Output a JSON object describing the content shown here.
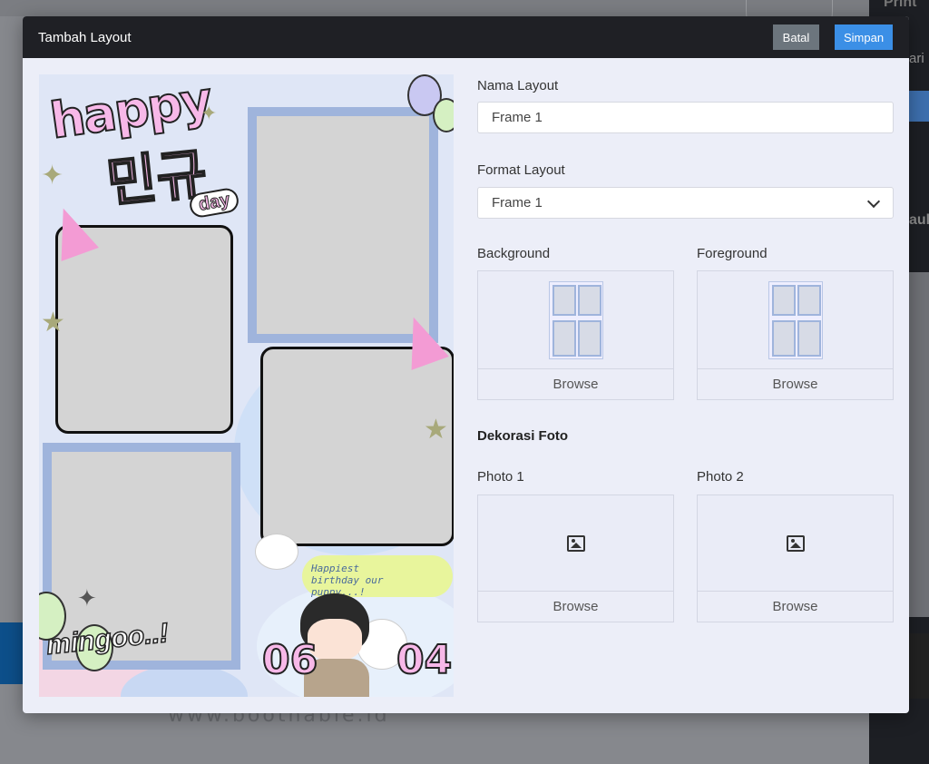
{
  "background": {
    "url_text": "www.boothable.id",
    "right_top_text": "Print",
    "right_input_text": "ari",
    "right_mid_text": "ault"
  },
  "modal": {
    "title": "Tambah Layout",
    "buttons": {
      "cancel": "Batal",
      "save": "Simpan"
    }
  },
  "preview": {
    "happy": "happy",
    "hangul": "민규",
    "day": "day",
    "birthday_text": "Happiest birthday our puppy...!",
    "num_left": "06",
    "num_right": "04",
    "mingoo": "mingoo..!"
  },
  "form": {
    "nama_label": "Nama Layout",
    "nama_value": "Frame 1",
    "format_label": "Format Layout",
    "format_value": "Frame 1",
    "background_label": "Background",
    "foreground_label": "Foreground",
    "browse": "Browse",
    "dekorasi_title": "Dekorasi Foto",
    "photo1_label": "Photo 1",
    "photo2_label": "Photo 2"
  },
  "icons": {
    "dropdown": "chevron-down-icon",
    "image": "image-icon"
  }
}
